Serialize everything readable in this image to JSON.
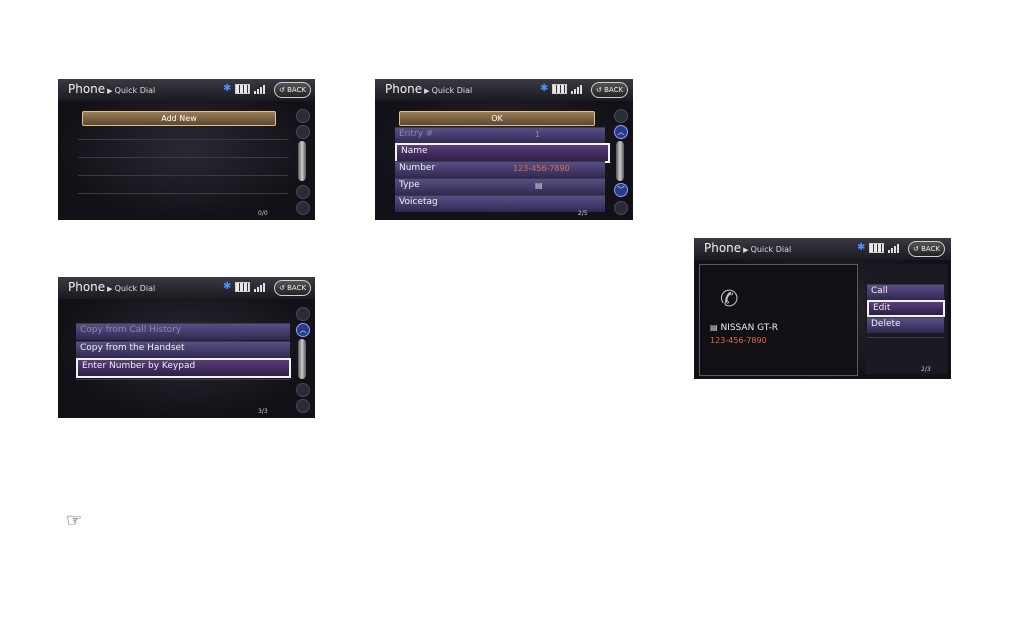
{
  "common": {
    "header_main": "Phone",
    "header_sub": "Quick Dial",
    "back_label": "BACK",
    "bluetooth_icon": "bluetooth-icon",
    "battery_icon": "battery-icon",
    "signal_icon": "signal-icon"
  },
  "screen1": {
    "add_new_label": "Add New",
    "counter": "0/0"
  },
  "screen2": {
    "items": [
      "Copy from Call History",
      "Copy from the Handset",
      "Enter Number by Keypad"
    ],
    "counter": "3/3"
  },
  "screen3": {
    "ok_label": "OK",
    "rows": [
      {
        "label": "Entry #",
        "value": "1"
      },
      {
        "label": "Name",
        "value": ""
      },
      {
        "label": "Number",
        "value": "123-456-7890"
      },
      {
        "label": "Type",
        "value": ""
      },
      {
        "label": "Voicetag",
        "value": ""
      }
    ],
    "counter": "2/5",
    "number_color": "#e06a4a"
  },
  "screen4": {
    "contact_name": "NISSAN GT-R",
    "contact_number": "123-456-7890",
    "menu": [
      "Call",
      "Edit",
      "Delete"
    ],
    "counter": "2/3"
  },
  "page": {
    "reference_icon": "pointing-hand-icon"
  }
}
